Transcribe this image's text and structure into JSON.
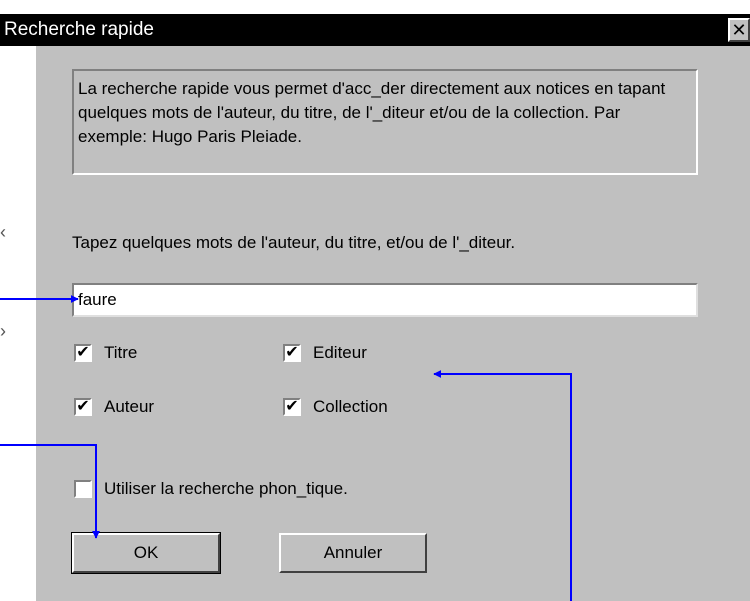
{
  "window": {
    "title": "Recherche rapide",
    "close_glyph": "✕"
  },
  "description": "La recherche rapide vous permet d'acc_der directement aux notices en tapant quelques mots de l'auteur, du titre, de l'_diteur et/ou de la collection. Par exemple: Hugo Paris Pleiade.",
  "search": {
    "label": "Tapez quelques mots de l'auteur, du titre, et/ou de l'_diteur.",
    "value": "faure"
  },
  "filters": [
    {
      "label": "Titre",
      "checked": true
    },
    {
      "label": "Editeur",
      "checked": true
    },
    {
      "label": "Auteur",
      "checked": true
    },
    {
      "label": "Collection",
      "checked": true
    }
  ],
  "phonetic": {
    "label": "Utiliser la recherche phon_tique.",
    "checked": false
  },
  "buttons": {
    "ok": "OK",
    "cancel": "Annuler"
  },
  "annotation_color": "#0000ff",
  "check_glyph": "✔",
  "icons": [
    "close-icon",
    "checkmark-icon",
    "annotation-arrow"
  ]
}
